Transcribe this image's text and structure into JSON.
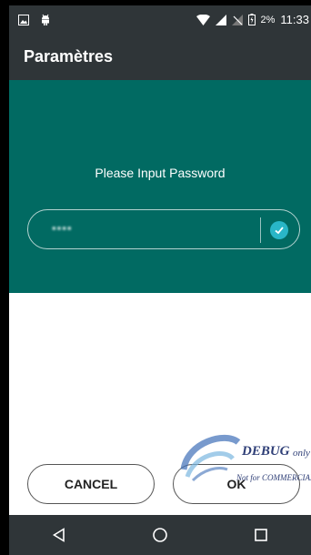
{
  "status_bar": {
    "left_icons": [
      "image-icon",
      "android-debug-icon"
    ],
    "right_icons": [
      "wifi-icon",
      "signal-icon",
      "no-sim-icon",
      "battery-icon"
    ],
    "battery_percent": "2%",
    "time": "11:33"
  },
  "app_bar": {
    "title": "Paramètres"
  },
  "dialog": {
    "prompt": "Please Input Password",
    "password_value": "▪▪▪▪",
    "confirm_icon": "check-icon",
    "cancel_label": "CANCEL",
    "ok_label": "OK"
  },
  "watermark": {
    "brand": "DEBUG",
    "suffix": "only",
    "note": "Not for COMMERCIAL"
  },
  "nav_bar": {
    "items": [
      "back-icon",
      "home-icon",
      "recents-icon"
    ]
  },
  "colors": {
    "bar": "#2f3538",
    "teal": "#016a62",
    "accent": "#29b6c7"
  }
}
